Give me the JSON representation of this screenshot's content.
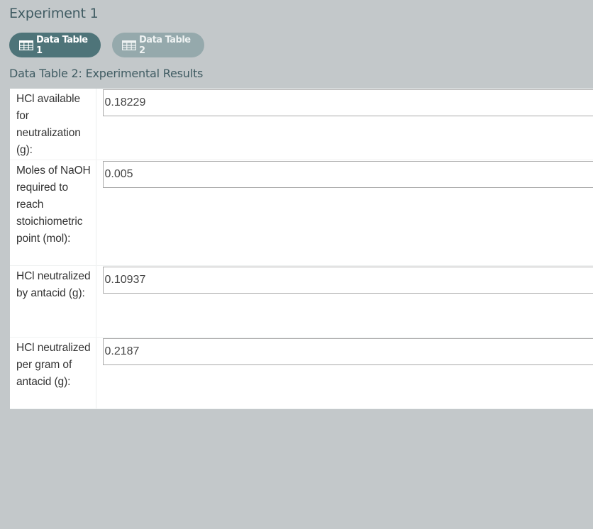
{
  "experiment": {
    "title": "Experiment 1"
  },
  "tabs": [
    {
      "label": "Data Table 1",
      "icon": "table-icon",
      "active": true
    },
    {
      "label": "Data Table 2",
      "icon": "table-icon",
      "active": false
    }
  ],
  "table": {
    "title": "Data Table 2: Experimental Results",
    "rows": [
      {
        "label": "HCl available for neutralization (g):",
        "value": "0.18229"
      },
      {
        "label": "Moles of NaOH required to reach stoichiometric point (mol):",
        "value": "0.005"
      },
      {
        "label": "HCl neutralized by antacid (g):",
        "value": "0.10937"
      },
      {
        "label": "HCl neutralized per gram of antacid (g):",
        "value": "0.2187"
      }
    ]
  },
  "colors": {
    "background": "#c3c8ca",
    "active_tab": "#4e7479",
    "inactive_tab": "#95a9ac",
    "heading_text": "#3f5b62"
  }
}
